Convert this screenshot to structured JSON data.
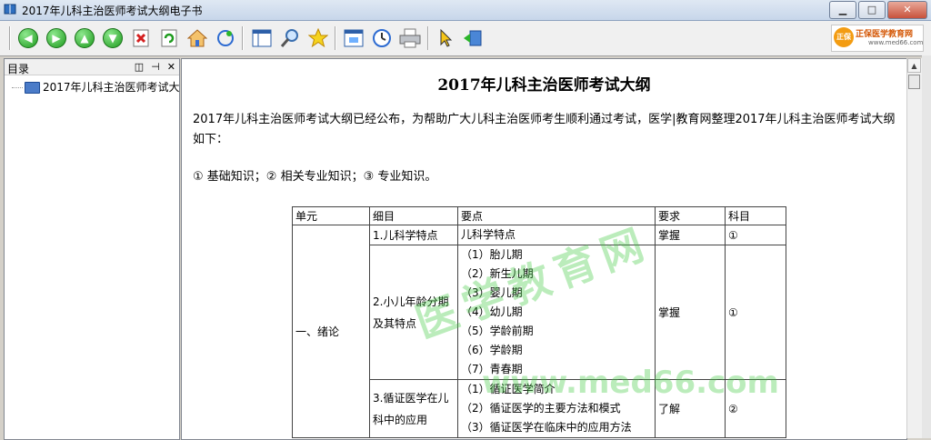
{
  "window": {
    "title": "2017年儿科主治医师考试大纲电子书"
  },
  "logo": {
    "mark": "正保",
    "text1": "正保医学教育网",
    "text2": "www.med66.com"
  },
  "sidebar": {
    "title": "目录",
    "items": [
      {
        "label": "2017年儿科主治医师考试大"
      }
    ]
  },
  "doc": {
    "title": "2017年儿科主治医师考试大纲",
    "intro": "2017年儿科主治医师考试大纲已经公布，为帮助广大儿科主治医师考生顺利通过考试，医学|教育网整理2017年儿科主治医师考试大纲如下：",
    "subjects": "① 基础知识；② 相关专业知识；③ 专业知识。",
    "watermark_cn": "医学教育网",
    "watermark_url": "www.med66.com",
    "table": {
      "headers": [
        "单元",
        "细目",
        "要点",
        "要求",
        "科目"
      ],
      "unit": "一、绪论",
      "rows": [
        {
          "detail": "1.儿科学特点",
          "points": [
            "儿科学特点"
          ],
          "req": "掌握",
          "subj": "①"
        },
        {
          "detail": "2.小儿年龄分期及其特点",
          "points": [
            "（1）胎儿期",
            "（2）新生儿期",
            "（3）婴儿期",
            "（4）幼儿期",
            "（5）学龄前期",
            "（6）学龄期",
            "（7）青春期"
          ],
          "req": "掌握",
          "subj": "①"
        },
        {
          "detail": "3.循证医学在儿科中的应用",
          "points": [
            "（1）循证医学简介",
            "（2）循证医学的主要方法和模式",
            "（3）循证医学在临床中的应用方法"
          ],
          "req": "了解",
          "subj": "②"
        }
      ]
    }
  }
}
